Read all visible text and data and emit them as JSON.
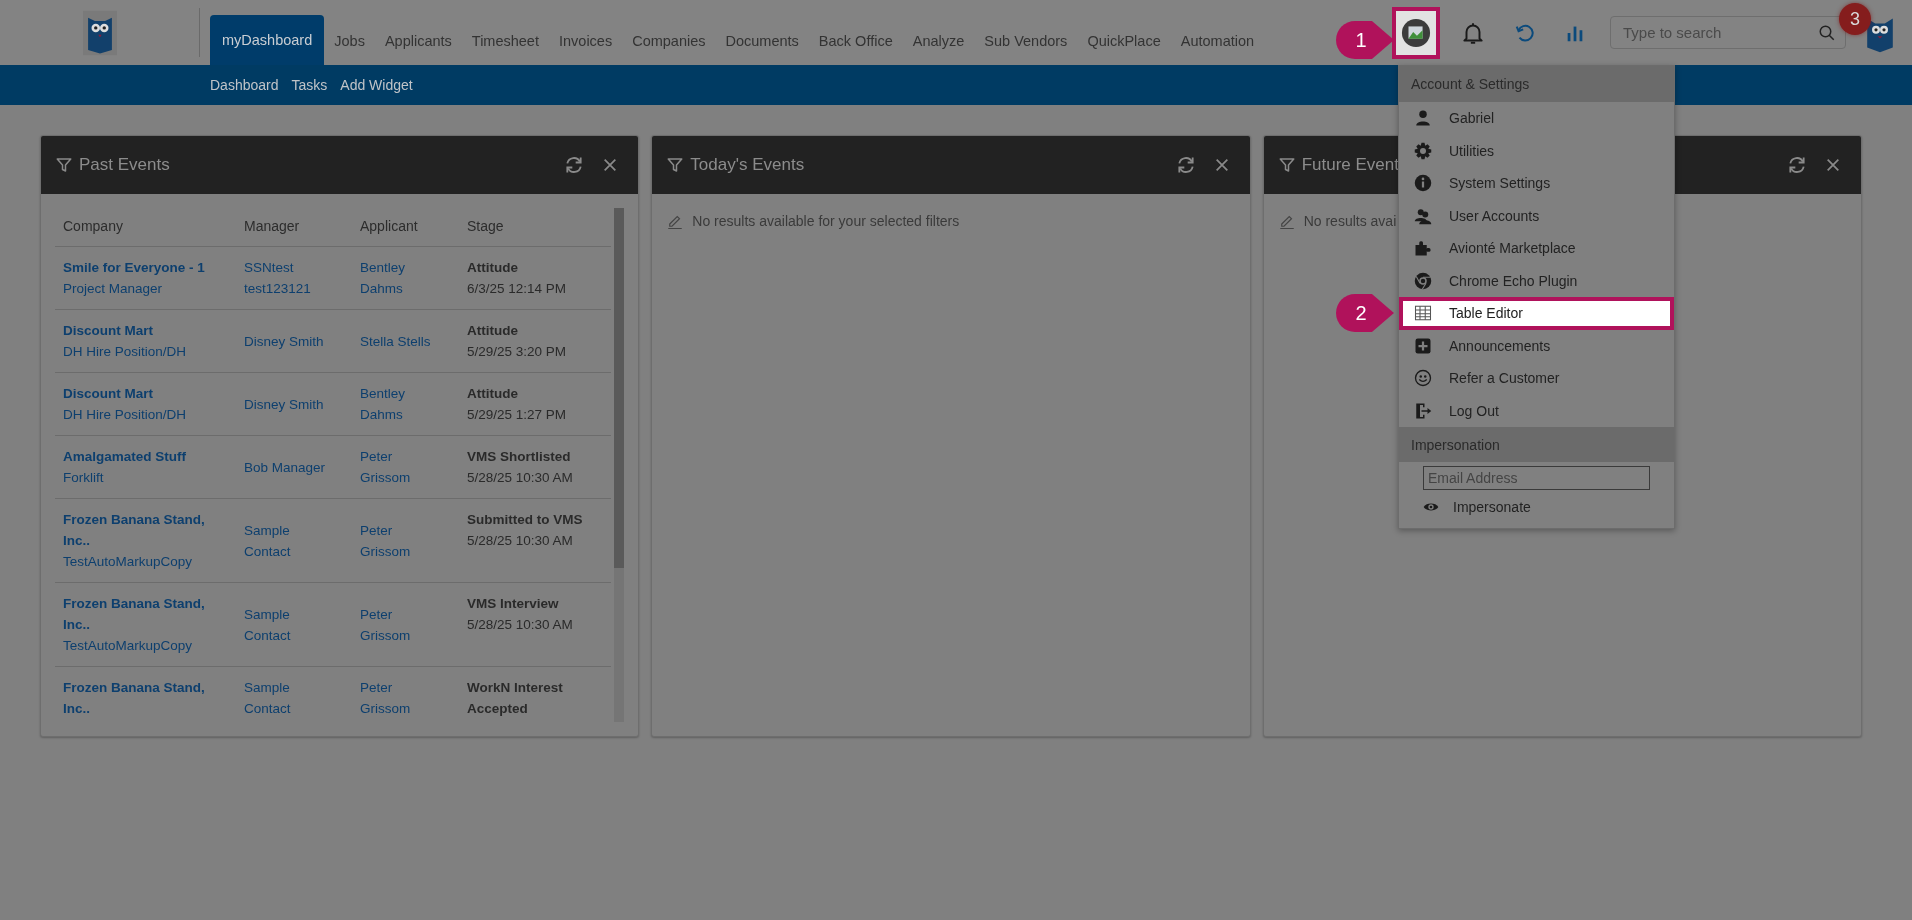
{
  "nav": {
    "tabs": [
      {
        "label": "myDashboard",
        "selected": true
      },
      {
        "label": "Jobs",
        "selected": false
      },
      {
        "label": "Applicants",
        "selected": false
      },
      {
        "label": "Timesheet",
        "selected": false
      },
      {
        "label": "Invoices",
        "selected": false
      },
      {
        "label": "Companies",
        "selected": false
      },
      {
        "label": "Documents",
        "selected": false
      },
      {
        "label": "Back Office",
        "selected": false
      },
      {
        "label": "Analyze",
        "selected": false
      },
      {
        "label": "Sub Vendors",
        "selected": false
      },
      {
        "label": "QuickPlace",
        "selected": false
      },
      {
        "label": "Automation",
        "selected": false
      }
    ],
    "subnav": [
      "Dashboard",
      "Tasks",
      "Add Widget"
    ]
  },
  "search": {
    "placeholder": "Type to search"
  },
  "panels": [
    {
      "title": "Past Events",
      "table": {
        "columns": [
          "Company",
          "Manager",
          "Applicant",
          "Stage"
        ],
        "rows": [
          {
            "company": "Smile for Everyone - 1",
            "company_sub": "Project Manager",
            "manager": "SSNtest test123121",
            "applicant": "Bentley Dahms",
            "stage": "Attitude",
            "time": "6/3/25 12:14 PM"
          },
          {
            "company": "Discount Mart",
            "company_sub": "DH Hire Position/DH",
            "manager": "Disney Smith",
            "applicant": "Stella Stells",
            "stage": "Attitude",
            "time": "5/29/25 3:20 PM"
          },
          {
            "company": "Discount Mart",
            "company_sub": "DH Hire Position/DH",
            "manager": "Disney Smith",
            "applicant": "Bentley Dahms",
            "stage": "Attitude",
            "time": "5/29/25 1:27 PM"
          },
          {
            "company": "Amalgamated Stuff",
            "company_sub": "Forklift",
            "manager": "Bob Manager",
            "applicant": "Peter Grissom",
            "stage": "VMS Shortlisted",
            "time": "5/28/25 10:30 AM"
          },
          {
            "company": "Frozen Banana Stand, Inc..",
            "company_sub": "TestAutoMarkupCopy",
            "manager": "Sample Contact",
            "applicant": "Peter Grissom",
            "stage": "Submitted to VMS",
            "time": "5/28/25 10:30 AM"
          },
          {
            "company": "Frozen Banana Stand, Inc..",
            "company_sub": "TestAutoMarkupCopy",
            "manager": "Sample Contact",
            "applicant": "Peter Grissom",
            "stage": "VMS Interview",
            "time": "5/28/25 10:30 AM"
          },
          {
            "company": "Frozen Banana Stand, Inc..",
            "manager": "Sample Contact",
            "applicant": "Peter Grissom",
            "stage": "WorkN Interest Accepted"
          }
        ]
      }
    },
    {
      "title": "Today's Events",
      "empty_message": "No results available for your selected filters"
    },
    {
      "title": "Future Event",
      "empty_message": "No results avai"
    }
  ],
  "menu": {
    "header": "Account & Settings",
    "items": [
      {
        "label": "Gabriel",
        "highlighted": false
      },
      {
        "label": "Utilities",
        "highlighted": false
      },
      {
        "label": "System Settings",
        "highlighted": false
      },
      {
        "label": "User Accounts",
        "highlighted": false
      },
      {
        "label": "Avionté Marketplace",
        "highlighted": false
      },
      {
        "label": "Chrome Echo Plugin",
        "highlighted": false
      },
      {
        "label": "Table Editor",
        "highlighted": true
      },
      {
        "label": "Announcements",
        "highlighted": false
      },
      {
        "label": "Refer a Customer",
        "highlighted": false
      },
      {
        "label": "Log Out",
        "highlighted": false
      }
    ],
    "impersonation": {
      "header": "Impersonation",
      "email": {
        "placeholder": "Email Address"
      },
      "button": "Impersonate"
    }
  },
  "callouts": [
    {
      "label": "1",
      "color": "#b0125b"
    },
    {
      "label": "2",
      "color": "#b0125b"
    },
    {
      "label": "3",
      "color": "#851d1d"
    }
  ]
}
